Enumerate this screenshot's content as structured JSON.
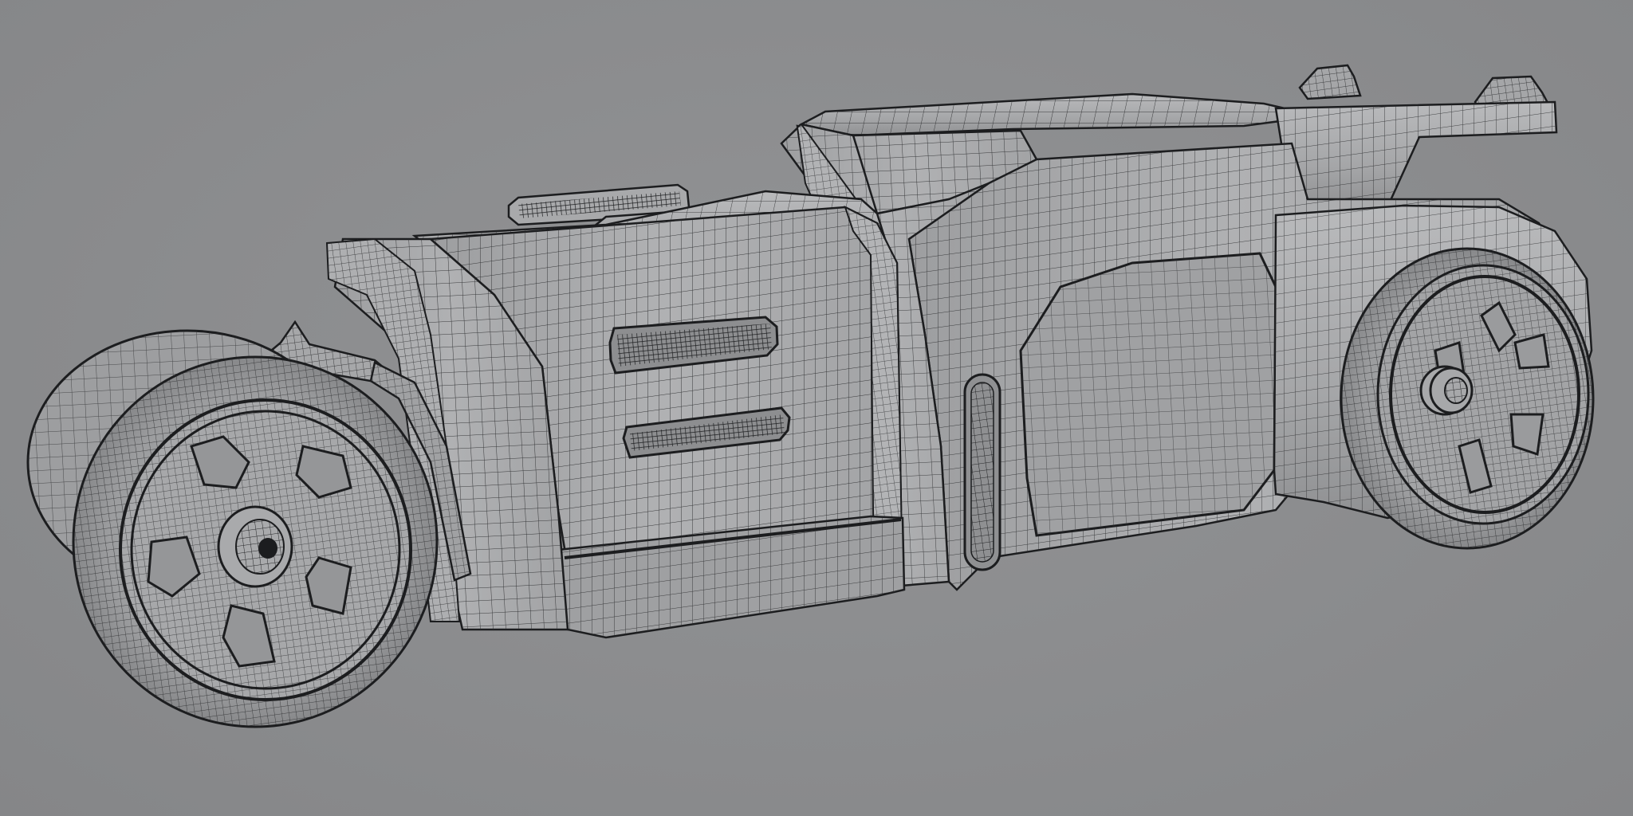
{
  "scene": {
    "background_color": "#8a8b8d",
    "model_surface_color": "#a9aaac",
    "wire_color": "#2a2b2d",
    "edge_color": "#1c1d1f",
    "shading": "wireframe-on-shaded",
    "object": "hot-rod-vehicle"
  }
}
